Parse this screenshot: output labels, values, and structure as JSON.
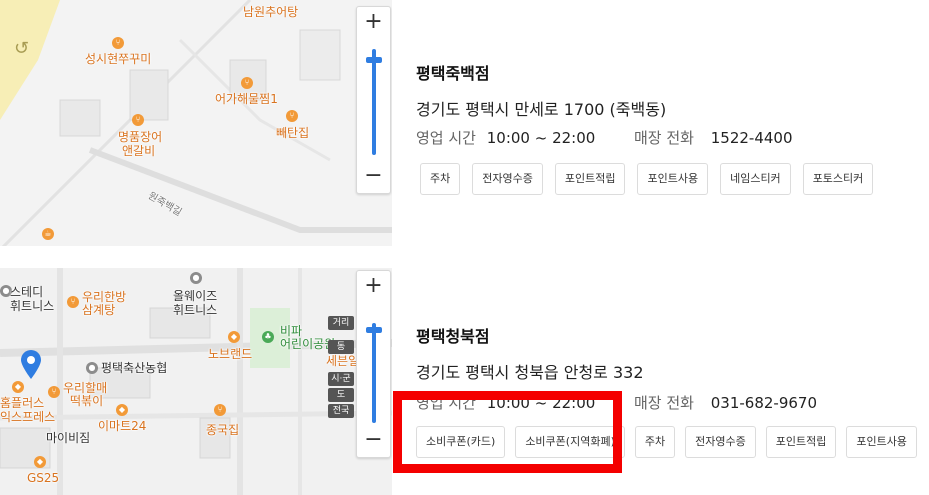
{
  "stores": [
    {
      "name": "평택죽백점",
      "address": "경기도 평택시 만세로 1700 (죽백동)",
      "hours_label": "영업 시간",
      "hours_value": "10:00 ~ 22:00",
      "phone_label": "매장 전화",
      "phone_value": "1522-4400",
      "tags": [
        "주차",
        "전자영수증",
        "포인트적립",
        "포인트사용",
        "네임스티커",
        "포토스티커"
      ],
      "map": {
        "labels": [
          "남원추어탕",
          "성시현쭈꾸미",
          "어가해물찜1",
          "명품장어",
          "앤갈비",
          "빼탄집",
          "원죽백길"
        ],
        "zoom_in": "+",
        "zoom_out": "−"
      }
    },
    {
      "name": "평택청북점",
      "address": "경기도 평택시 청북읍 안청로 332",
      "hours_label": "영업 시간",
      "hours_value": "10:00 ~ 22:00",
      "phone_label": "매장 전화",
      "phone_value": "031-682-9670",
      "tags": [
        "소비쿠폰(카드)",
        "소비쿠폰(지역화폐)",
        "주차",
        "전자영수증",
        "포인트적립",
        "포인트사용"
      ],
      "map": {
        "labels": [
          "스테디",
          "휘트니스",
          "우리한방",
          "삼계탕",
          "올웨이즈",
          "휘트니스",
          "비파",
          "어린이공원",
          "노브랜드",
          "평택축산농협",
          "세븐일",
          "우리할매",
          "떡볶이",
          "홈플러스",
          "익스프레스",
          "이마트24",
          "종국집",
          "마이비짐",
          "GS25"
        ],
        "scale_tags": [
          "거리",
          "동",
          "시·군",
          "도",
          "전국"
        ],
        "zoom_in": "+",
        "zoom_out": "−"
      }
    }
  ],
  "colors": {
    "accent": "#2f7de1",
    "highlight": "#f40000",
    "poi_orange": "#f29a38"
  }
}
